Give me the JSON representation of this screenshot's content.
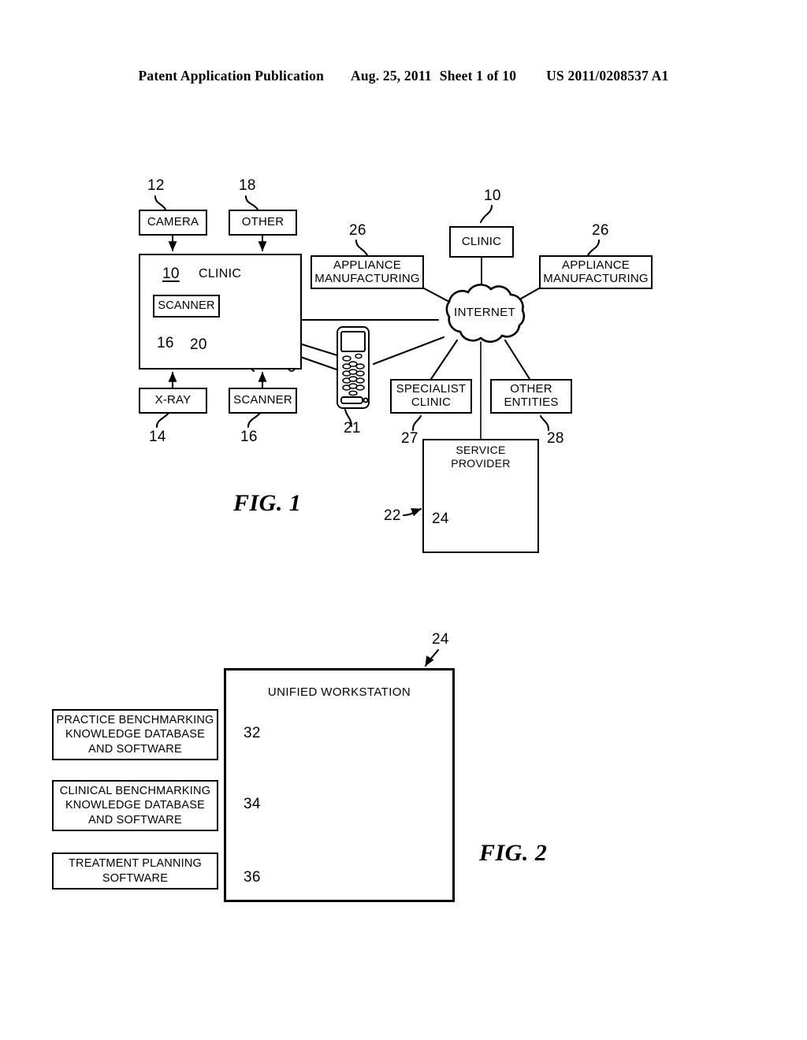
{
  "header": {
    "publication": "Patent Application Publication",
    "date": "Aug. 25, 2011",
    "sheet": "Sheet 1 of 10",
    "patent_number": "US 2011/0208537 A1"
  },
  "figure1": {
    "caption": "FIG. 1",
    "boxes": {
      "camera": "CAMERA",
      "other": "OTHER",
      "clinic_local_title": "CLINIC",
      "clinic_local_ref": "10",
      "scanner_inner": "SCANNER",
      "xray": "X-RAY",
      "scanner_bottom": "SCANNER",
      "appliance_manufacturing_left": "APPLIANCE\nMANUFACTURING",
      "appliance_manufacturing_left_line1": "APPLIANCE",
      "appliance_manufacturing_left_line2": "MANUFACTURING",
      "appliance_manufacturing_right_line1": "APPLIANCE",
      "appliance_manufacturing_right_line2": "MANUFACTURING",
      "clinic_remote": "CLINIC",
      "internet": "INTERNET",
      "specialist_clinic_line1": "SPECIALIST",
      "specialist_clinic_line2": "CLINIC",
      "other_entities_line1": "OTHER",
      "other_entities_line2": "ENTITIES",
      "service_provider_line1": "SERVICE",
      "service_provider_line2": "PROVIDER"
    },
    "refs": {
      "camera": "12",
      "other": "18",
      "clinic_local": "10",
      "scanner_inner": "16",
      "workstation_local": "20",
      "xray": "14",
      "scanner_bottom": "16",
      "mobile": "21",
      "appliance_left": "26",
      "appliance_right": "26",
      "clinic_remote": "10",
      "specialist_clinic": "27",
      "other_entities": "28",
      "service_provider": "22",
      "workstation_sp": "24"
    }
  },
  "figure2": {
    "caption": "FIG. 2",
    "title": "UNIFIED WORKSTATION",
    "ref_top": "24",
    "modules": [
      {
        "ref": "32",
        "line1": "PRACTICE BENCHMARKING",
        "line2": "KNOWLEDGE DATABASE",
        "line3": "AND SOFTWARE"
      },
      {
        "ref": "34",
        "line1": "CLINICAL BENCHMARKING",
        "line2": "KNOWLEDGE DATABASE",
        "line3": "AND SOFTWARE"
      },
      {
        "ref": "36",
        "line1": "TREATMENT PLANNING",
        "line2": "SOFTWARE",
        "line3": ""
      }
    ]
  },
  "colors": {
    "ink": "#000000",
    "paper": "#ffffff"
  }
}
